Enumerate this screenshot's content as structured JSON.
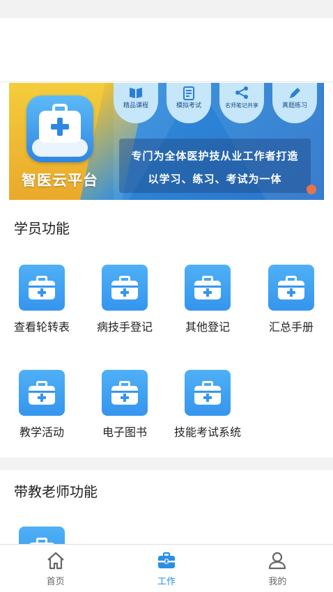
{
  "banner": {
    "brand_name": "智医云平台",
    "features": [
      {
        "label": "精品课程",
        "icon": "book-icon"
      },
      {
        "label": "模拟考试",
        "icon": "exam-icon"
      },
      {
        "label": "名师笔记共享",
        "icon": "share-icon"
      },
      {
        "label": "真题练习",
        "icon": "pencil-icon"
      }
    ],
    "slogan_line1": "专门为全体医护技从业工作者打造",
    "slogan_line2": "以学习、练习、考试为一体",
    "colors": {
      "primary": "#2d86d8",
      "accent": "#f4cd3c"
    }
  },
  "student_section": {
    "title": "学员功能",
    "items": [
      {
        "label": "查看轮转表",
        "icon": "medical-kit-icon"
      },
      {
        "label": "病技手登记",
        "icon": "medical-kit-icon"
      },
      {
        "label": "其他登记",
        "icon": "medical-kit-icon"
      },
      {
        "label": "汇总手册",
        "icon": "medical-kit-icon"
      },
      {
        "label": "教学活动",
        "icon": "medical-kit-icon"
      },
      {
        "label": "电子图书",
        "icon": "medical-kit-icon"
      },
      {
        "label": "技能考试系统",
        "icon": "medical-kit-icon"
      }
    ]
  },
  "teacher_section": {
    "title": "带教老师功能",
    "items": [
      {
        "label": "",
        "icon": "medical-kit-icon"
      }
    ]
  },
  "bottom_nav": {
    "active": "工作",
    "active_color": "#2a8ee6",
    "items": [
      {
        "label": "首页",
        "icon": "home-icon"
      },
      {
        "label": "工作",
        "icon": "briefcase-icon"
      },
      {
        "label": "我的",
        "icon": "user-icon"
      }
    ]
  }
}
